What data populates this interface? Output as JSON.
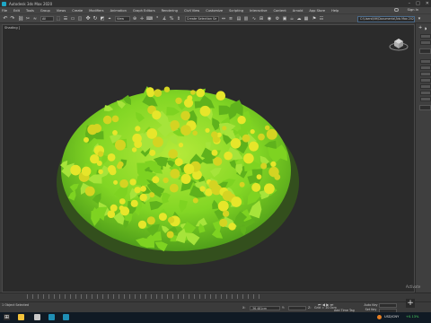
{
  "window": {
    "title": "Autodesk 3ds Max 2020"
  },
  "menubar": {
    "items": [
      "File",
      "Edit",
      "Tools",
      "Group",
      "Views",
      "Create",
      "Modifiers",
      "Animation",
      "Graph Editors",
      "Rendering",
      "Civil View",
      "Customize",
      "Scripting",
      "Interactive",
      "Content",
      "Arnold",
      "App Store",
      "Help"
    ],
    "signin_label": "Sign In"
  },
  "toolbar": {
    "selection_filter": "All",
    "reference_coord": "View",
    "named_selection": "Create Selection Se",
    "workspace_path": "C:\\Users\\NH\\Documents\\3ds Max 2020"
  },
  "viewport": {
    "label": "[+] [Perspective] [Standard] [Default Shading]",
    "label_visible": "Shading ]"
  },
  "trackbar": {
    "tick_count": 20
  },
  "status": {
    "selection": "1 Object Selected",
    "x_label": "X:",
    "x_value": "-36.481cm",
    "y_label": "Y:",
    "y_value": "",
    "z_label": "Z:",
    "grid": "Grid = 10.0cm",
    "add_time_tag": "Add Time Tag",
    "auto_key": "Auto Key",
    "set_key": "Set Key",
    "selected": "Selected",
    "frame_value": "0",
    "plus": "+"
  },
  "watermark": {
    "activate": "Activate"
  },
  "taskbar": {
    "currency": "USD/CNY",
    "change": "+0.13%"
  },
  "colors": {
    "plant_green": "#7ed321",
    "flower_yellow": "#e6e62a",
    "viewport_bg": "#2b2b2b"
  }
}
